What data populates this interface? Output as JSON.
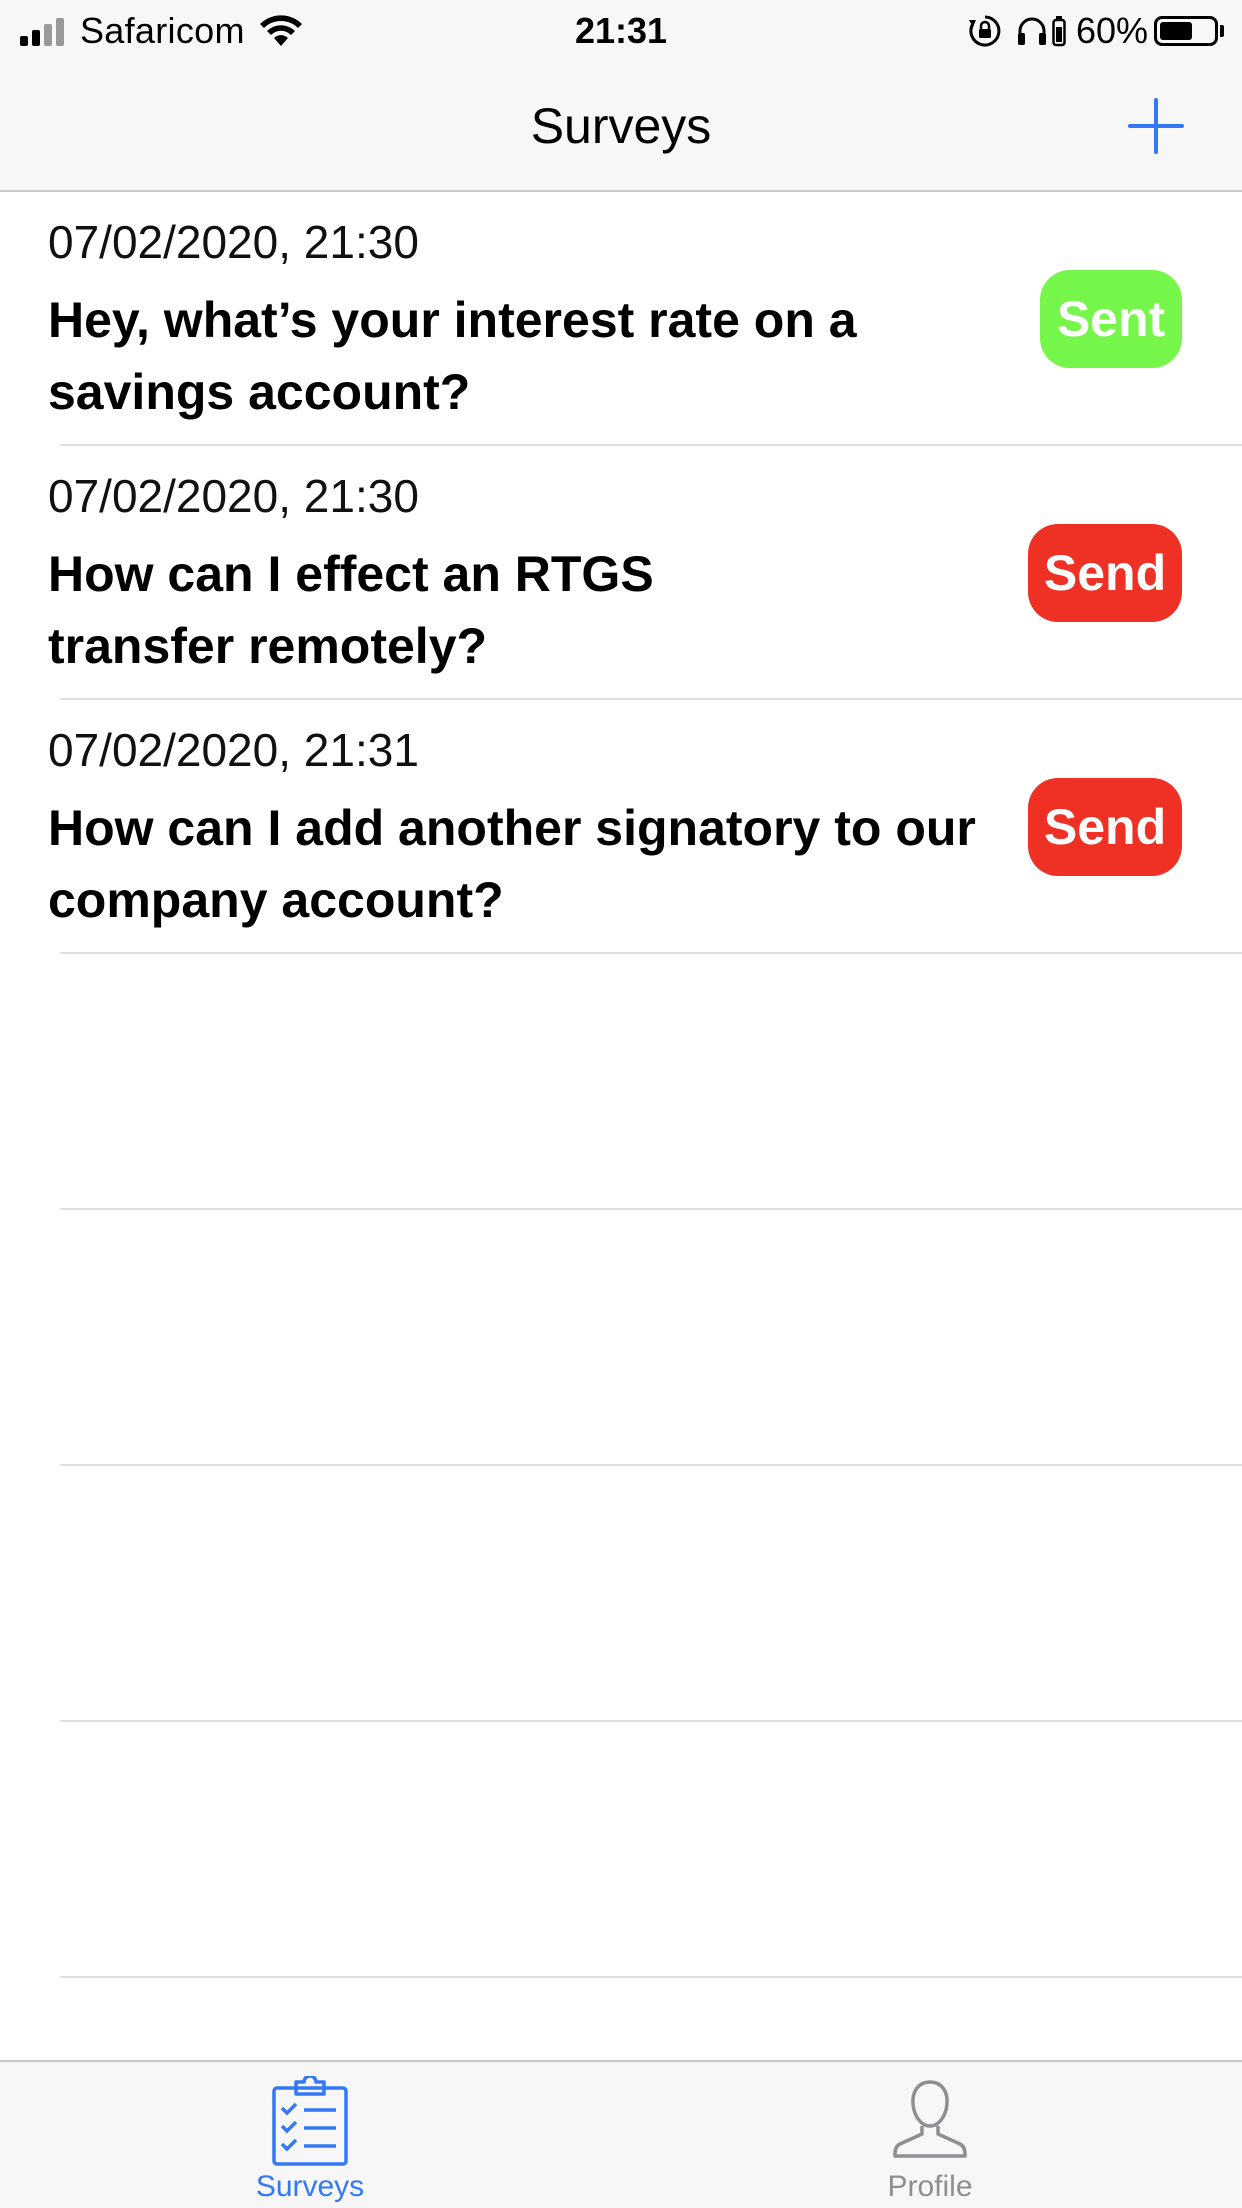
{
  "status_bar": {
    "carrier": "Safaricom",
    "time": "21:31",
    "battery_percent": "60%"
  },
  "nav": {
    "title": "Surveys",
    "add_icon": "plus-icon"
  },
  "colors": {
    "accent": "#3478f6",
    "sent_green": "#76f54a",
    "send_red": "#ee3124",
    "inactive_gray": "#8e8e93"
  },
  "surveys": [
    {
      "date": "07/02/2020, 21:30",
      "title": "Hey, what’s your interest rate on a savings account?",
      "status_label": "Sent",
      "status": "sent"
    },
    {
      "date": "07/02/2020, 21:30",
      "title": "How can I effect an RTGS transfer remotely?",
      "status_label": "Send",
      "status": "pending"
    },
    {
      "date": "07/02/2020, 21:31",
      "title": "How can I add another signatory to our company account?",
      "status_label": "Send",
      "status": "pending"
    }
  ],
  "tabs": [
    {
      "label": "Surveys",
      "icon": "clipboard-checklist-icon",
      "active": true
    },
    {
      "label": "Profile",
      "icon": "person-icon",
      "active": false
    }
  ]
}
